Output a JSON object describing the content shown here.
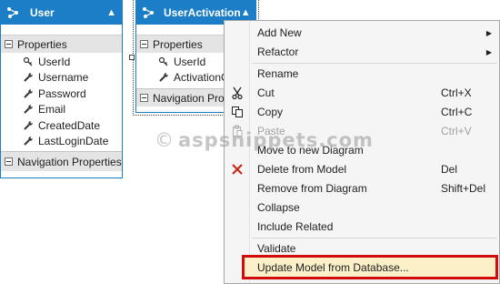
{
  "colors": {
    "accent": "#1c7ec6",
    "highlight_border": "#d10c0c",
    "highlight_bg": "#fbf0c8",
    "delete_icon": "#c42b1c"
  },
  "entities": [
    {
      "title": "User",
      "properties_label": "Properties",
      "properties": [
        {
          "name": "UserId",
          "icon": "key-wrench-icon"
        },
        {
          "name": "Username",
          "icon": "wrench-icon"
        },
        {
          "name": "Password",
          "icon": "wrench-icon"
        },
        {
          "name": "Email",
          "icon": "wrench-icon"
        },
        {
          "name": "CreatedDate",
          "icon": "wrench-icon"
        },
        {
          "name": "LastLoginDate",
          "icon": "wrench-icon"
        }
      ],
      "navigation_label": "Navigation Properties"
    },
    {
      "title": "UserActivation",
      "properties_label": "Properties",
      "properties": [
        {
          "name": "UserId",
          "icon": "key-wrench-icon"
        },
        {
          "name": "ActivationCo",
          "icon": "wrench-icon"
        }
      ],
      "navigation_label": "Navigation Prop"
    }
  ],
  "context_menu": {
    "items": [
      {
        "label": "Add New",
        "submenu": true
      },
      {
        "label": "Refactor",
        "submenu": true
      },
      {
        "label": "Rename"
      },
      {
        "label": "Cut",
        "shortcut": "Ctrl+X",
        "icon": "scissors-icon"
      },
      {
        "label": "Copy",
        "shortcut": "Ctrl+C",
        "icon": "copy-icon"
      },
      {
        "label": "Paste",
        "shortcut": "Ctrl+V",
        "icon": "paste-icon",
        "disabled": true
      },
      {
        "label": "Move to new Diagram"
      },
      {
        "label": "Delete from Model",
        "shortcut": "Del",
        "icon": "delete-x-icon"
      },
      {
        "label": "Remove from Diagram",
        "shortcut": "Shift+Del"
      },
      {
        "label": "Collapse"
      },
      {
        "label": "Include Related"
      },
      {
        "label": "Validate"
      },
      {
        "label": "Update Model from Database...",
        "highlighted": true
      }
    ]
  },
  "watermark": {
    "symbol": "©",
    "text": "aspsnippets.com"
  }
}
